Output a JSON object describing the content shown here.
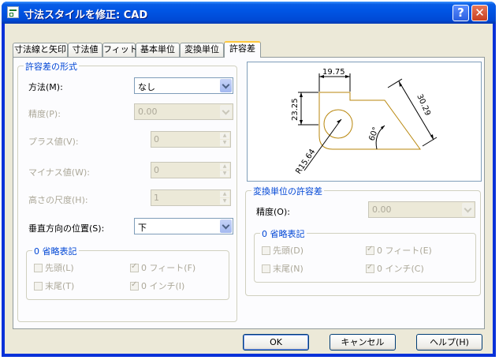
{
  "window": {
    "title": "寸法スタイルを修正: CAD",
    "help_glyph": "?",
    "close_glyph": "✕"
  },
  "tabs": [
    {
      "label": "寸法線と矢印"
    },
    {
      "label": "寸法値"
    },
    {
      "label": "フィット"
    },
    {
      "label": "基本単位"
    },
    {
      "label": "変換単位"
    },
    {
      "label": "許容差"
    }
  ],
  "tolerance_format": {
    "legend": "許容差の形式",
    "method_label": "方法(M):",
    "method_value": "なし",
    "precision_label": "精度(P):",
    "precision_value": "0.00",
    "plus_label": "プラス値(V):",
    "plus_value": "0",
    "minus_label": "マイナス値(W):",
    "minus_value": "0",
    "height_label": "高さの尺度(H):",
    "height_value": "1",
    "vertical_label": "垂直方向の位置(S):",
    "vertical_value": "下"
  },
  "zero_suppression": {
    "legend": "0 省略表記",
    "leading": "先頭(L)",
    "feet": "0 フィート(F)",
    "trailing": "末尾(T)",
    "inches": "0 インチ(I)",
    "leading_checked": false,
    "feet_checked": true,
    "trailing_checked": false,
    "inches_checked": true
  },
  "alt_unit_tolerance": {
    "legend": "変換単位の許容差",
    "precision_label": "精度(O):",
    "precision_value": "0.00"
  },
  "alt_zero_suppression": {
    "legend": "0 省略表記",
    "leading": "先頭(D)",
    "feet": "0 フィート(E)",
    "trailing": "末尾(N)",
    "inches": "0 インチ(C)",
    "leading_checked": false,
    "feet_checked": true,
    "trailing_checked": false,
    "inches_checked": true
  },
  "preview": {
    "dim_top": "19.75",
    "dim_left": "23.25",
    "dim_right": "30.29",
    "angle": "60°",
    "radius": "R15.64"
  },
  "buttons": {
    "ok": "OK",
    "cancel": "キャンセル",
    "help": "ヘルプ(H)"
  }
}
